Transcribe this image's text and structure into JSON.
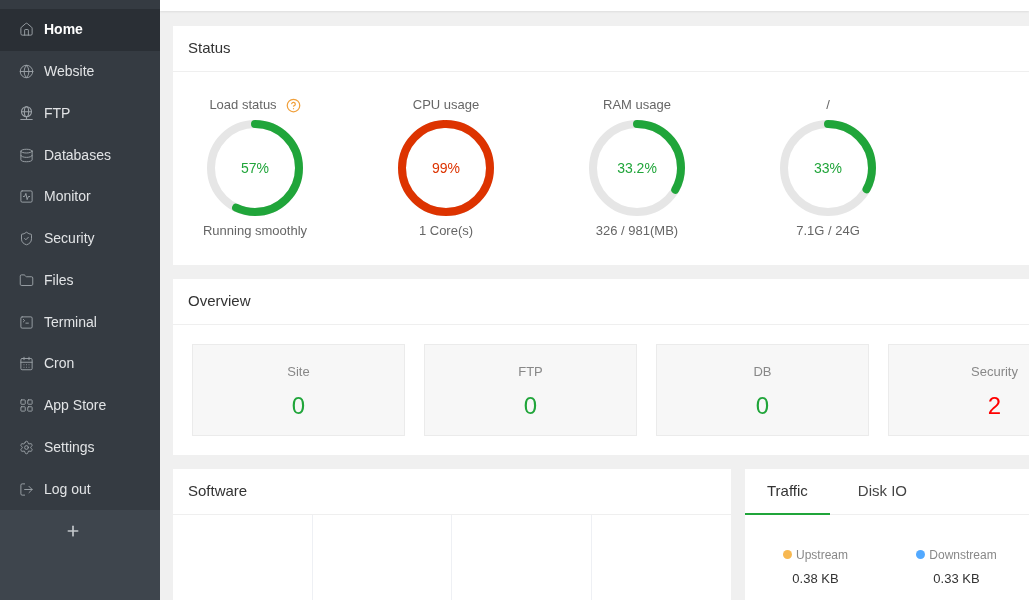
{
  "sidebar": {
    "items": [
      {
        "label": "Home",
        "selected": true
      },
      {
        "label": "Website",
        "selected": false
      },
      {
        "label": "FTP",
        "selected": false
      },
      {
        "label": "Databases",
        "selected": false
      },
      {
        "label": "Monitor",
        "selected": false
      },
      {
        "label": "Security",
        "selected": false
      },
      {
        "label": "Files",
        "selected": false
      },
      {
        "label": "Terminal",
        "selected": false
      },
      {
        "label": "Cron",
        "selected": false
      },
      {
        "label": "App Store",
        "selected": false
      },
      {
        "label": "Settings",
        "selected": false
      },
      {
        "label": "Log out",
        "selected": false
      }
    ]
  },
  "status": {
    "title": "Status",
    "gauges": [
      {
        "title": "Load status",
        "help_icon": true,
        "value": "57%",
        "level": 0.57,
        "color": "#20a53a",
        "caption": "Running smoothly"
      },
      {
        "title": "CPU usage",
        "help_icon": false,
        "value": "99%",
        "level": 0.99,
        "color": "#dd3300",
        "caption": "1 Core(s)"
      },
      {
        "title": "RAM usage",
        "help_icon": false,
        "value": "33.2%",
        "level": 0.332,
        "color": "#20a53a",
        "caption": "326 / 981(MB)"
      },
      {
        "title": "/",
        "help_icon": false,
        "value": "33%",
        "level": 0.33,
        "color": "#20a53a",
        "caption": "7.1G / 24G"
      }
    ]
  },
  "overview": {
    "title": "Overview",
    "tiles": [
      {
        "label": "Site",
        "value": "0",
        "color": "#20a53a"
      },
      {
        "label": "FTP",
        "value": "0",
        "color": "#20a53a"
      },
      {
        "label": "DB",
        "value": "0",
        "color": "#20a53a"
      },
      {
        "label": "Security",
        "value": "2",
        "color": "#ff0000"
      }
    ]
  },
  "software": {
    "title": "Software"
  },
  "traffic": {
    "tabs": [
      {
        "label": "Traffic",
        "selected": true
      },
      {
        "label": "Disk IO",
        "selected": false
      }
    ],
    "legend": [
      {
        "label": "Upstream",
        "color": "#f7b851",
        "value": "0.38 KB"
      },
      {
        "label": "Downstream",
        "color": "#52a9ff",
        "value": "0.33 KB"
      }
    ]
  }
}
